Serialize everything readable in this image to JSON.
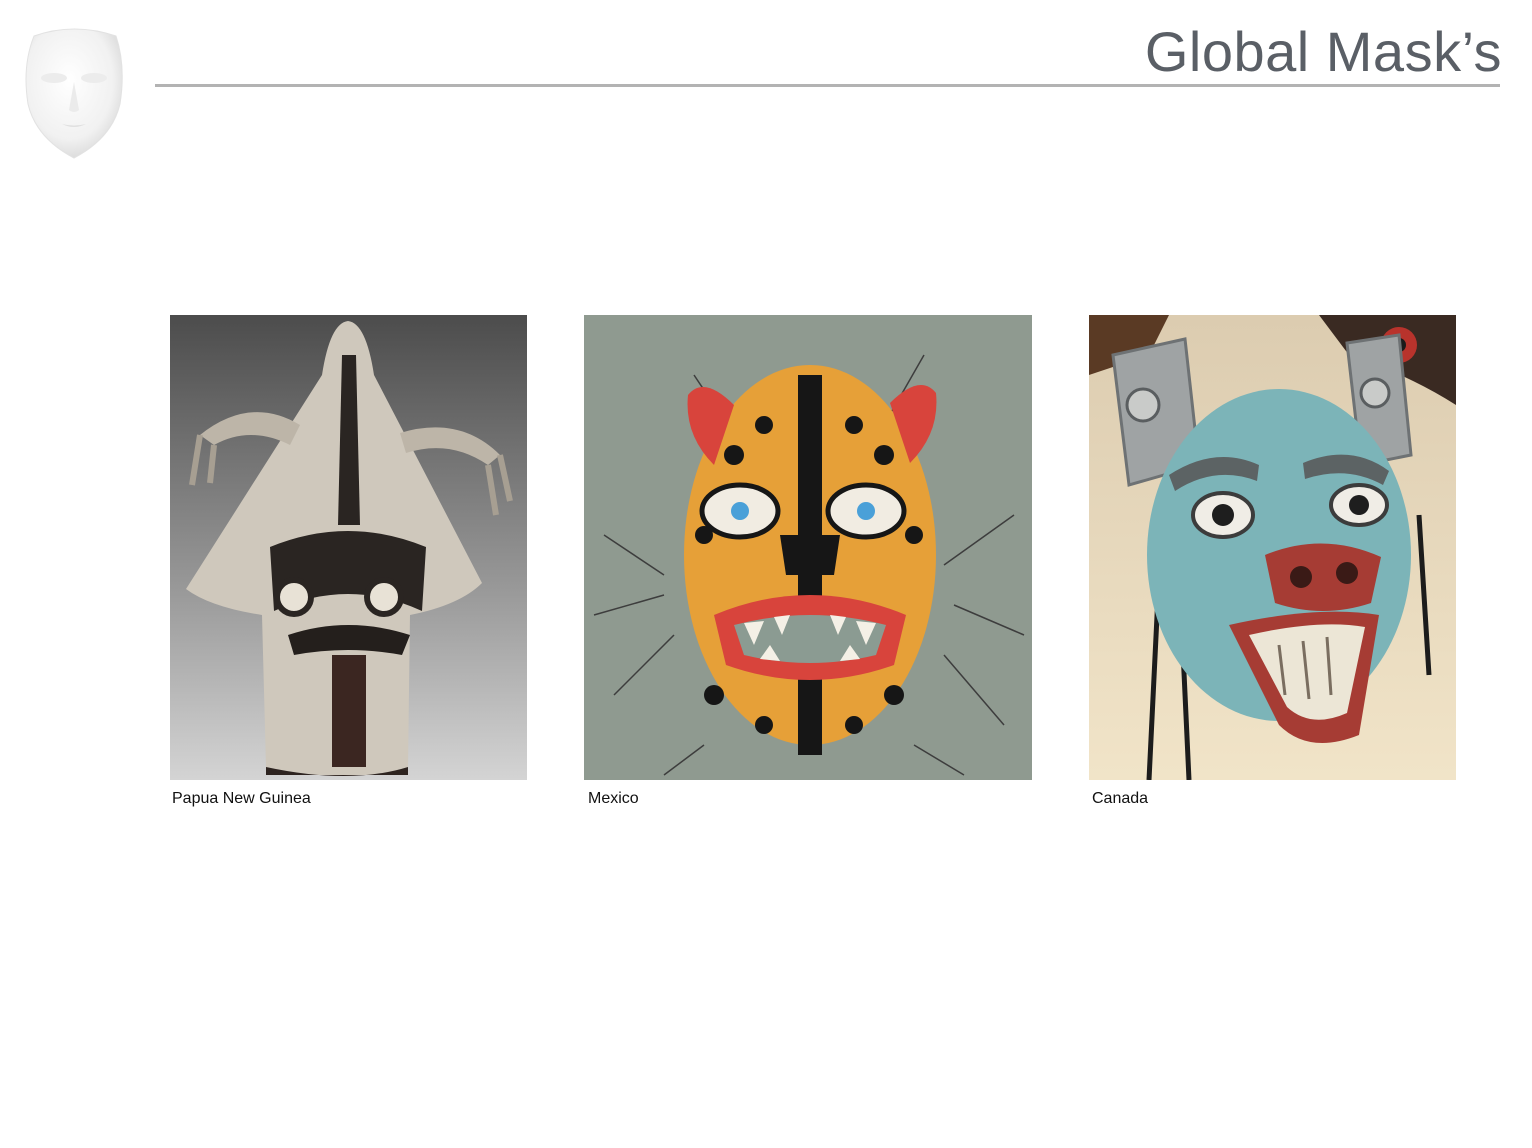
{
  "slide": {
    "title": "Global Mask’s",
    "logo_icon": "white-face-mask-icon"
  },
  "gallery": [
    {
      "caption": "Papua New Guinea",
      "image": "papua-new-guinea-mask-photo"
    },
    {
      "caption": "Mexico",
      "image": "mexican-jaguar-mask-photo"
    },
    {
      "caption": "Canada",
      "image": "canadian-bear-mask-photo"
    }
  ],
  "colors": {
    "title": "#5a5f66",
    "rule": "#b3b3b3",
    "caption": "#111111"
  }
}
